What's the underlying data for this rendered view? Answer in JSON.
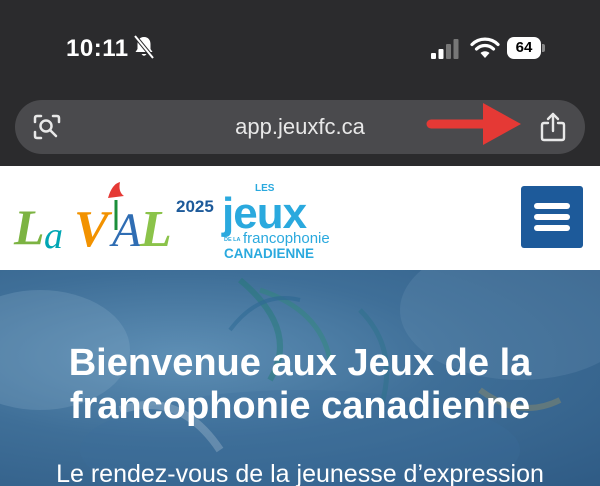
{
  "status_bar": {
    "time": "10:11",
    "battery": "64",
    "icons": [
      "bell-slash-icon",
      "signal-icon",
      "wifi-icon",
      "battery-icon"
    ]
  },
  "browser": {
    "url": "app.jeuxfc.ca",
    "icons": [
      "visual-lookup-icon",
      "share-icon"
    ],
    "annotation_color": "#e53935"
  },
  "header": {
    "logo": {
      "city": "LaVAL",
      "year": "2025",
      "les": "LES",
      "jeux": "jeux",
      "de_la": "DE LA",
      "francophonie": "francophonie",
      "canadienne": "CANADIENNE"
    },
    "menu_icon": "hamburger-menu-icon",
    "brand_color": "#1d5a9a"
  },
  "hero": {
    "title": "Bienvenue aux Jeux de la francophonie canadienne",
    "subtitle": "Le rendez-vous de la jeunesse d’expression"
  }
}
